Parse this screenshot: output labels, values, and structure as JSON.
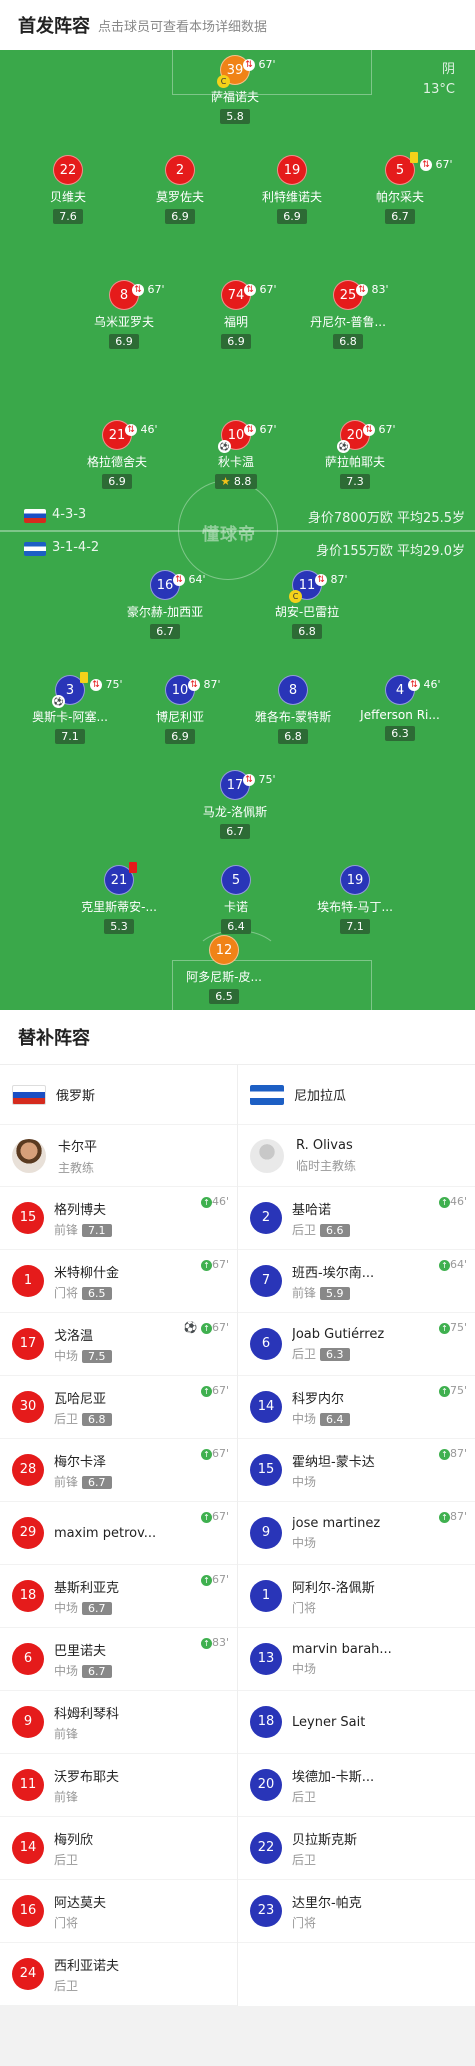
{
  "header": {
    "title": "首发阵容",
    "subtitle": "点击球员可查看本场详细数据"
  },
  "weather": {
    "condition": "阴",
    "temp": "13°C"
  },
  "watermark": "懂球帝",
  "home_team": {
    "formation": "4-3-3",
    "value": "身价7800万欧  平均25.5岁"
  },
  "away_team": {
    "formation": "3-1-4-2",
    "value": "身价155万欧  平均29.0岁"
  },
  "home_players": [
    {
      "num": "39",
      "name": "萨福诺夫",
      "rating": "5.8",
      "color": "orange",
      "sub": "67'",
      "captain": true
    },
    {
      "num": "22",
      "name": "贝维夫",
      "rating": "7.6",
      "color": "red"
    },
    {
      "num": "2",
      "name": "莫罗佐夫",
      "rating": "6.9",
      "color": "red"
    },
    {
      "num": "19",
      "name": "利特维诺夫",
      "rating": "6.9",
      "color": "red"
    },
    {
      "num": "5",
      "name": "帕尔采夫",
      "rating": "6.7",
      "color": "red",
      "sub": "67'",
      "yellow": true
    },
    {
      "num": "8",
      "name": "乌米亚罗夫",
      "rating": "6.9",
      "color": "red",
      "sub": "67'"
    },
    {
      "num": "74",
      "name": "福明",
      "rating": "6.9",
      "color": "red",
      "sub": "67'"
    },
    {
      "num": "25",
      "name": "丹尼尔-普鲁...",
      "rating": "6.8",
      "color": "red",
      "sub": "83'"
    },
    {
      "num": "21",
      "name": "格拉德舍夫",
      "rating": "6.9",
      "color": "red",
      "sub": "46'"
    },
    {
      "num": "10",
      "name": "秋卡温",
      "rating": "8.8",
      "color": "red",
      "sub": "67'",
      "goal": true,
      "star": true
    },
    {
      "num": "20",
      "name": "萨拉帕耶夫",
      "rating": "7.3",
      "color": "red",
      "sub": "67'",
      "goal": true
    }
  ],
  "away_players": [
    {
      "num": "16",
      "name": "豪尔赫-加西亚",
      "rating": "6.7",
      "color": "blue",
      "sub": "64'"
    },
    {
      "num": "11",
      "name": "胡安-巴雷拉",
      "rating": "6.8",
      "color": "blue",
      "sub": "87'",
      "captain": true
    },
    {
      "num": "3",
      "name": "奥斯卡-阿塞...",
      "rating": "7.1",
      "color": "blue",
      "sub": "75'",
      "yellow": true,
      "goal": true
    },
    {
      "num": "10",
      "name": "博尼利亚",
      "rating": "6.9",
      "color": "blue",
      "sub": "87'"
    },
    {
      "num": "8",
      "name": "雅各布-蒙特斯",
      "rating": "6.8",
      "color": "blue"
    },
    {
      "num": "4",
      "name": "Jefferson Ri...",
      "rating": "6.3",
      "color": "blue",
      "sub": "46'"
    },
    {
      "num": "17",
      "name": "马龙-洛佩斯",
      "rating": "6.7",
      "color": "blue",
      "sub": "75'"
    },
    {
      "num": "21",
      "name": "克里斯蒂安-...",
      "rating": "5.3",
      "color": "blue",
      "red": true
    },
    {
      "num": "5",
      "name": "卡诺",
      "rating": "6.4",
      "color": "blue"
    },
    {
      "num": "19",
      "name": "埃布特-马丁...",
      "rating": "7.1",
      "color": "blue"
    },
    {
      "num": "12",
      "name": "阿多尼斯-皮...",
      "rating": "6.5",
      "color": "orange"
    }
  ],
  "subs": {
    "title": "替补阵容",
    "home": {
      "team": "俄罗斯",
      "coach": {
        "name": "卡尔平",
        "role": "主教练"
      },
      "players": [
        {
          "num": "15",
          "name": "格列博夫",
          "pos": "前锋",
          "rating": "7.1",
          "time": "46'"
        },
        {
          "num": "1",
          "name": "米特柳什金",
          "pos": "门将",
          "rating": "6.5",
          "time": "67'"
        },
        {
          "num": "17",
          "name": "戈洛温",
          "pos": "中场",
          "rating": "7.5",
          "time": "67'",
          "goal": true
        },
        {
          "num": "30",
          "name": "瓦哈尼亚",
          "pos": "后卫",
          "rating": "6.8",
          "time": "67'"
        },
        {
          "num": "28",
          "name": "梅尔卡泽",
          "pos": "前锋",
          "rating": "6.7",
          "time": "67'"
        },
        {
          "num": "29",
          "name": "maxim petrov...",
          "pos": "",
          "rating": "",
          "time": "67'"
        },
        {
          "num": "18",
          "name": "基斯利亚克",
          "pos": "中场",
          "rating": "6.7",
          "time": "67'"
        },
        {
          "num": "6",
          "name": "巴里诺夫",
          "pos": "中场",
          "rating": "6.7",
          "time": "83'"
        },
        {
          "num": "9",
          "name": "科姆利琴科",
          "pos": "前锋",
          "rating": "",
          "time": ""
        },
        {
          "num": "11",
          "name": "沃罗布耶夫",
          "pos": "前锋",
          "rating": "",
          "time": ""
        },
        {
          "num": "14",
          "name": "梅列欣",
          "pos": "后卫",
          "rating": "",
          "time": ""
        },
        {
          "num": "16",
          "name": "阿达莫夫",
          "pos": "门将",
          "rating": "",
          "time": ""
        },
        {
          "num": "24",
          "name": "西利亚诺夫",
          "pos": "后卫",
          "rating": "",
          "time": ""
        }
      ]
    },
    "away": {
      "team": "尼加拉瓜",
      "coach": {
        "name": "R. Olivas",
        "role": "临时主教练"
      },
      "players": [
        {
          "num": "2",
          "name": "基哈诺",
          "pos": "后卫",
          "rating": "6.6",
          "time": "46'"
        },
        {
          "num": "7",
          "name": "班西-埃尔南...",
          "pos": "前锋",
          "rating": "5.9",
          "time": "64'"
        },
        {
          "num": "6",
          "name": "Joab Gutiérrez",
          "pos": "后卫",
          "rating": "6.3",
          "time": "75'"
        },
        {
          "num": "14",
          "name": "科罗内尔",
          "pos": "中场",
          "rating": "6.4",
          "time": "75'"
        },
        {
          "num": "15",
          "name": "霍纳坦-蒙卡达",
          "pos": "中场",
          "rating": "",
          "time": "87'"
        },
        {
          "num": "9",
          "name": "jose martinez",
          "pos": "中场",
          "rating": "",
          "time": "87'"
        },
        {
          "num": "1",
          "name": "阿利尔-洛佩斯",
          "pos": "门将",
          "rating": "",
          "time": ""
        },
        {
          "num": "13",
          "name": "marvin barah...",
          "pos": "中场",
          "rating": "",
          "time": ""
        },
        {
          "num": "18",
          "name": "Leyner Sait",
          "pos": "",
          "rating": "",
          "time": ""
        },
        {
          "num": "20",
          "name": "埃德加-卡斯...",
          "pos": "后卫",
          "rating": "",
          "time": ""
        },
        {
          "num": "22",
          "name": "贝拉斯克斯",
          "pos": "后卫",
          "rating": "",
          "time": ""
        },
        {
          "num": "23",
          "name": "达里尔-帕克",
          "pos": "门将",
          "rating": "",
          "time": ""
        }
      ]
    }
  }
}
